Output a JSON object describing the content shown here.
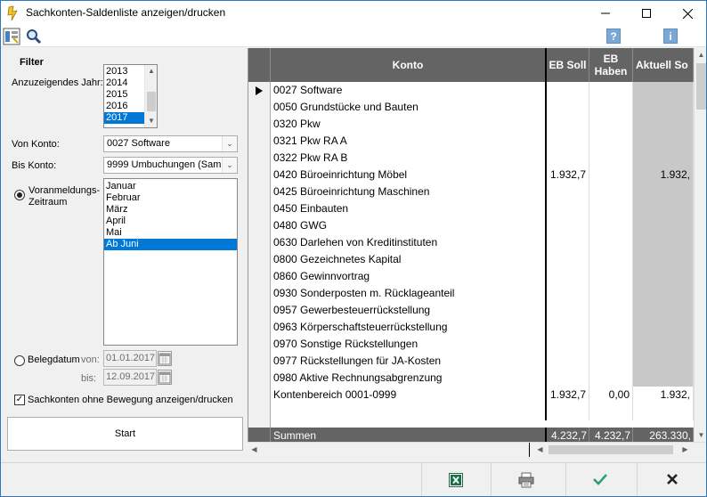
{
  "window": {
    "title": "Sachkonten-Saldenliste anzeigen/drucken",
    "minimize": "—",
    "maximize": "☐",
    "close": "✕"
  },
  "toolbar": {
    "help_label": "?",
    "info_label": "i"
  },
  "filter": {
    "title": "Filter",
    "year_label": "Anzuzeigendes Jahr:",
    "years": [
      "2013",
      "2014",
      "2015",
      "2016",
      "2017"
    ],
    "selected_year": "2017",
    "from_account_label": "Von Konto:",
    "from_account_value": "0027 Software",
    "to_account_label": "Bis Konto:",
    "to_account_value": "9999 Umbuchungen (Samm",
    "period_radio_label_1": "Voranmeldungs-",
    "period_radio_label_2": "Zeitraum",
    "periods": [
      "Januar",
      "Februar",
      "März",
      "April",
      "Mai",
      "Ab Juni"
    ],
    "selected_period": "Ab Juni",
    "belegdatum_label": "Belegdatum",
    "von_label": "von:",
    "bis_label": "bis:",
    "date_from": "01.01.2017",
    "date_to": "12.09.2017",
    "checkbox_label": "Sachkonten ohne Bewegung anzeigen/drucken",
    "start_label": "Start"
  },
  "grid": {
    "columns": [
      "Konto",
      "EB Soll",
      "EB Haben",
      "Aktuell So"
    ],
    "rows": [
      {
        "konto": "0027 Software",
        "eb_soll": "",
        "eb_haben": "",
        "aktuell": ""
      },
      {
        "konto": "0050 Grundstücke und Bauten",
        "eb_soll": "",
        "eb_haben": "",
        "aktuell": ""
      },
      {
        "konto": "0320 Pkw",
        "eb_soll": "",
        "eb_haben": "",
        "aktuell": ""
      },
      {
        "konto": "0321 Pkw RA A",
        "eb_soll": "",
        "eb_haben": "",
        "aktuell": ""
      },
      {
        "konto": "0322 Pkw RA B",
        "eb_soll": "",
        "eb_haben": "",
        "aktuell": ""
      },
      {
        "konto": "0420 Büroeinrichtung Möbel",
        "eb_soll": "1.932,7",
        "eb_haben": "",
        "aktuell": "1.932,"
      },
      {
        "konto": "0425 Büroeinrichtung Maschinen",
        "eb_soll": "",
        "eb_haben": "",
        "aktuell": ""
      },
      {
        "konto": "0450 Einbauten",
        "eb_soll": "",
        "eb_haben": "",
        "aktuell": ""
      },
      {
        "konto": "0480 GWG",
        "eb_soll": "",
        "eb_haben": "",
        "aktuell": ""
      },
      {
        "konto": "0630 Darlehen von Kreditinstituten",
        "eb_soll": "",
        "eb_haben": "",
        "aktuell": ""
      },
      {
        "konto": "0800 Gezeichnetes Kapital",
        "eb_soll": "",
        "eb_haben": "",
        "aktuell": ""
      },
      {
        "konto": "0860 Gewinnvortrag",
        "eb_soll": "",
        "eb_haben": "",
        "aktuell": ""
      },
      {
        "konto": "0930 Sonderposten m. Rücklageanteil",
        "eb_soll": "",
        "eb_haben": "",
        "aktuell": ""
      },
      {
        "konto": "0957 Gewerbesteuerrückstellung",
        "eb_soll": "",
        "eb_haben": "",
        "aktuell": ""
      },
      {
        "konto": "0963 Körperschaftsteuerrückstellung",
        "eb_soll": "",
        "eb_haben": "",
        "aktuell": ""
      },
      {
        "konto": "0970 Sonstige Rückstellungen",
        "eb_soll": "",
        "eb_haben": "",
        "aktuell": ""
      },
      {
        "konto": "0977 Rückstellungen für JA-Kosten",
        "eb_soll": "",
        "eb_haben": "",
        "aktuell": ""
      },
      {
        "konto": "0980 Aktive Rechnungsabgrenzung",
        "eb_soll": "",
        "eb_haben": "",
        "aktuell": ""
      },
      {
        "konto": "Kontenbereich 0001-0999",
        "eb_soll": "1.932,7",
        "eb_haben": "0,00",
        "aktuell": "1.932,"
      },
      {
        "konto": "",
        "eb_soll": "",
        "eb_haben": "",
        "aktuell": ""
      }
    ],
    "sum_label": "Summen",
    "sum_eb_soll": "4.232,7",
    "sum_eb_haben": "4.232,7",
    "sum_aktuell": "263.330,"
  },
  "colors": {
    "header_bg": "#646464",
    "selection": "#0078d7",
    "excel_green": "#1d7044",
    "confirm": "#2e9e73"
  }
}
